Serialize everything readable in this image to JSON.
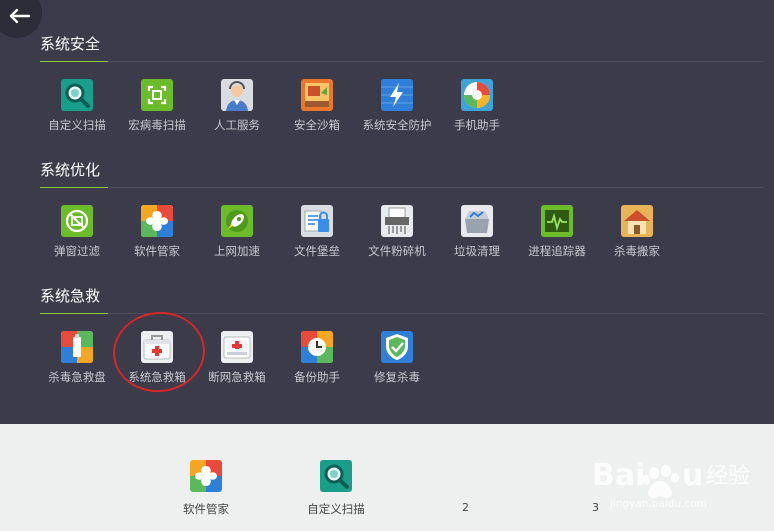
{
  "sections": [
    {
      "title": "系统安全",
      "items": [
        "自定义扫描",
        "宏病毒扫描",
        "人工服务",
        "安全沙箱",
        "系统安全防护",
        "手机助手"
      ]
    },
    {
      "title": "系统优化",
      "items": [
        "弹窗过滤",
        "软件管家",
        "上网加速",
        "文件堡垒",
        "文件粉碎机",
        "垃圾清理",
        "进程追踪器",
        "杀毒搬家"
      ]
    },
    {
      "title": "系统急救",
      "items": [
        "杀毒急救盘",
        "系统急救箱",
        "断网急救箱",
        "备份助手",
        "修复杀毒"
      ]
    }
  ],
  "bottom": {
    "items": [
      "软件管家",
      "自定义扫描"
    ],
    "pages": [
      "2",
      "3"
    ]
  },
  "watermark": {
    "site": "jingyan.baidu.com"
  },
  "colors": {
    "panel": "#3b3b49",
    "footer": "#eef0ef",
    "accent": "#8dc63f",
    "highlight": "#d42828"
  }
}
